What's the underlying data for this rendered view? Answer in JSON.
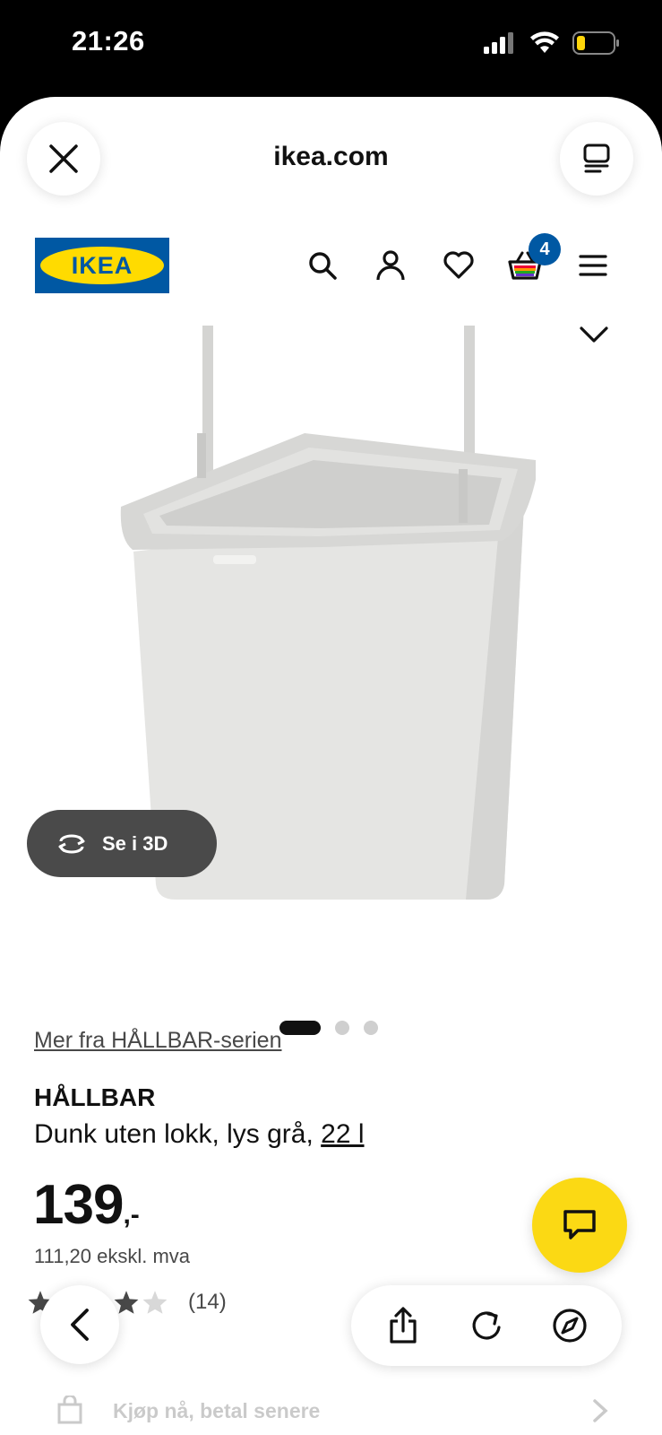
{
  "status_bar": {
    "time": "21:26",
    "battery_color": "#ffd60a"
  },
  "browser": {
    "url": "ikea.com",
    "close_icon": "close-icon",
    "tabs_icon": "tabs-icon"
  },
  "header": {
    "logo_text": "IKEA",
    "cart_count": "4",
    "icons": [
      "search-icon",
      "user-icon",
      "heart-icon",
      "cart-icon",
      "menu-icon"
    ],
    "brand_blue": "#0058a3",
    "brand_yellow": "#ffdb00"
  },
  "gallery": {
    "view_3d_label": "Se i 3D",
    "image_count": 3,
    "active_image": 1
  },
  "product": {
    "series_link": "Mer fra HÅLLBAR-serien",
    "name": "HÅLLBAR",
    "description": "Dunk uten lokk, lys grå, ",
    "size_link": "22 l",
    "price": "139",
    "price_suffix": ",-",
    "price_ex_vat": "111,20 ekskl. mva",
    "rating_value": 4,
    "rating_max": 5,
    "rating_count": "(14)"
  },
  "chat_button_color": "#fbd914",
  "faded_row": {
    "label": "Kjøp nå, betal senere"
  },
  "toolbar": {
    "icons": [
      "share-icon",
      "reload-icon",
      "compass-icon"
    ]
  }
}
